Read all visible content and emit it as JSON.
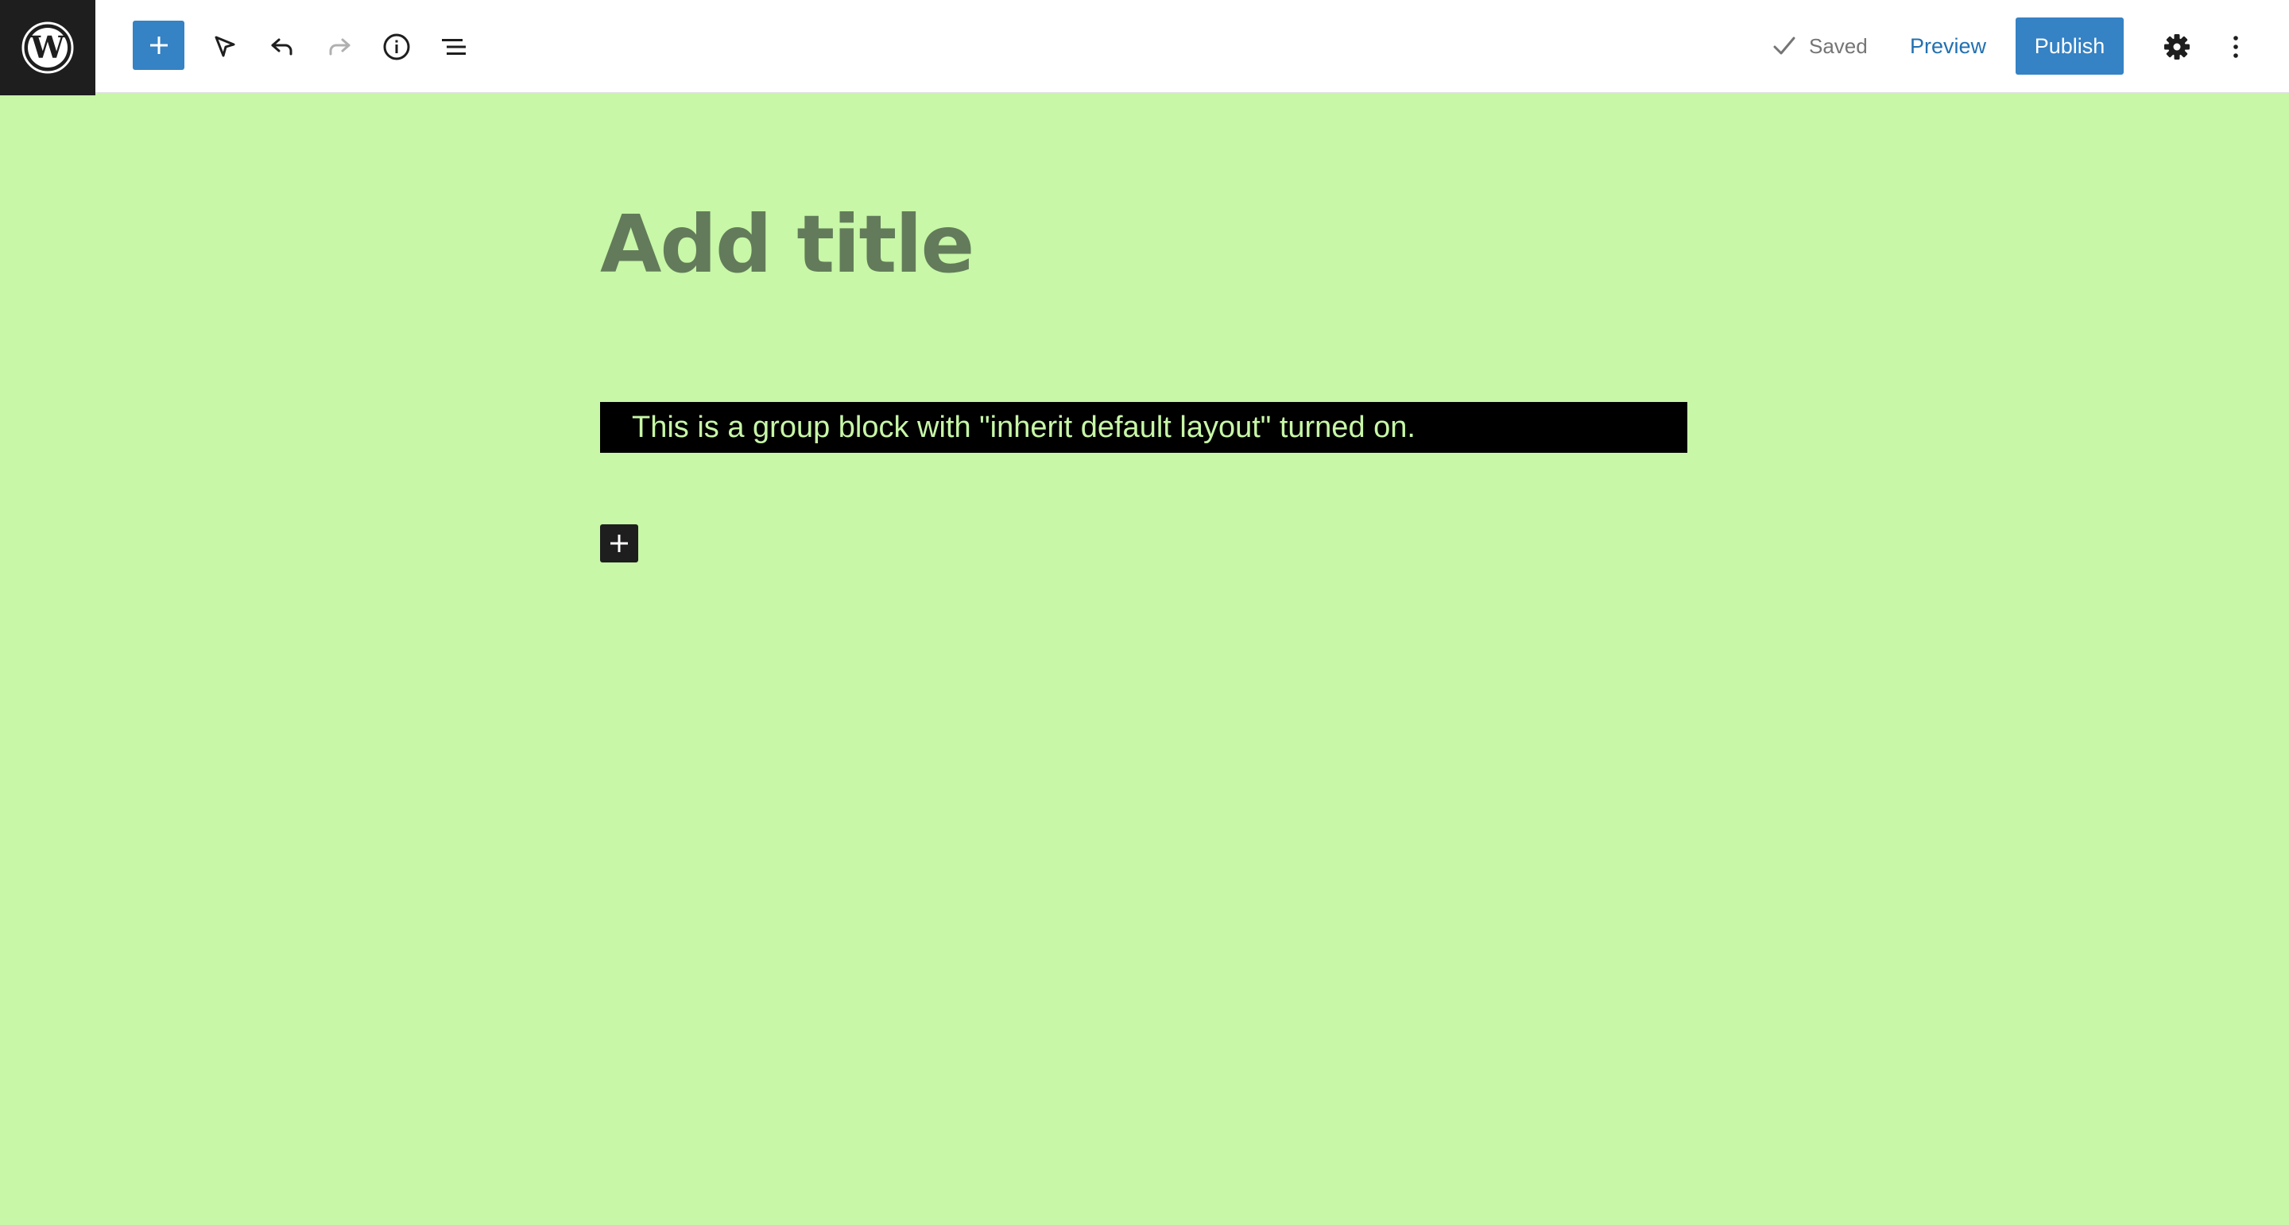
{
  "toolbar": {
    "logo_icon": "wordpress-logo-icon",
    "add_block_icon": "plus-icon",
    "select_icon": "select-arrow-icon",
    "undo_icon": "undo-icon",
    "redo_icon": "redo-icon",
    "info_icon": "info-icon",
    "list_view_icon": "list-view-icon",
    "saved_label": "Saved",
    "preview_label": "Preview",
    "publish_label": "Publish",
    "settings_icon": "gear-icon",
    "more_icon": "vertical-ellipsis-icon"
  },
  "editor": {
    "title_placeholder": "Add title",
    "group_text": "This is a group block with \"inherit default layout\" turned on.",
    "inserter_icon": "plus-icon"
  },
  "colors": {
    "canvas_background": "#c7f7a7",
    "accent_blue": "#3582c4",
    "title_color": "#637b5a",
    "group_background": "#000000",
    "group_text_color": "#c7f7a7"
  }
}
